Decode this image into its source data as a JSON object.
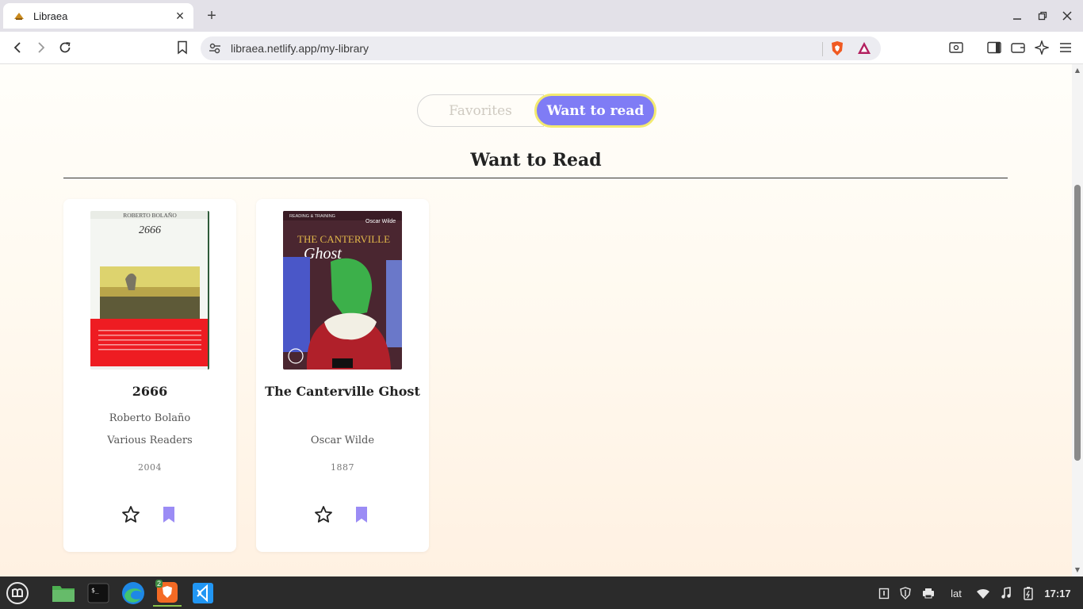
{
  "browser": {
    "tab_title": "Libraea",
    "url": "libraea.netlify.app/my-library"
  },
  "page": {
    "toggle": {
      "favorites_label": "Favorites",
      "want_to_read_label": "Want to read",
      "active": "Want to read"
    },
    "section_title": "Want to Read",
    "books": [
      {
        "title": "2666",
        "author": "Roberto Bolaño",
        "reader": "Various Readers",
        "year": "2004",
        "cover_text": {
          "author": "ROBERTO BOLAÑO",
          "title": "2666"
        }
      },
      {
        "title": "The Canterville Ghost",
        "author": "Oscar Wilde",
        "year": "1887",
        "cover_text": {
          "series": "READING & TRAINING",
          "author": "Oscar Wilde",
          "title_1": "THE CANTERVILLE",
          "title_2": "Ghost"
        }
      }
    ]
  },
  "taskbar": {
    "keyboard_layout": "lat",
    "clock": "17:17",
    "brave_badge": "2"
  },
  "colors": {
    "accent": "#7f7cf5",
    "toggle_border": "#f3ea70",
    "bookmark": "#9b8cf5"
  }
}
